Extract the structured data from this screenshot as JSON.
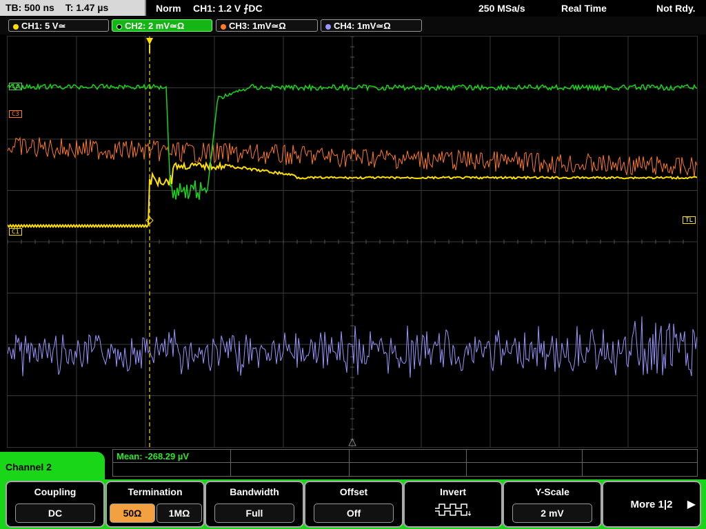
{
  "top": {
    "tb_label": "TB: 500 ns",
    "t_label": "T: 1.47 µs",
    "mode": "Norm",
    "trigger": "CH1: 1.2 V ⨍DC",
    "rate": "250 MSa/s",
    "acq": "Real Time",
    "state": "Not Rdy."
  },
  "channels": [
    {
      "label": "CH1: 5 V≃",
      "color": "#ffe000"
    },
    {
      "label": "CH2: 2 mV≃Ω",
      "color": "#19d619"
    },
    {
      "label": "CH3: 1mV≃Ω",
      "color": "#ff7a2a"
    },
    {
      "label": "CH4: 1mV≃Ω",
      "color": "#9a96ff"
    }
  ],
  "markers": {
    "c3": "C3",
    "c3b": "C3",
    "c1": "C1",
    "tl": "TL"
  },
  "measurement": {
    "mean": "Mean: -268.29 µV"
  },
  "menu": {
    "channel_title": "Channel 2",
    "coupling": {
      "title": "Coupling",
      "value": "DC"
    },
    "termination": {
      "title": "Termination",
      "opt1": "50Ω",
      "opt2": "1MΩ"
    },
    "bandwidth": {
      "title": "Bandwidth",
      "value": "Full"
    },
    "offset": {
      "title": "Offset",
      "value": "Off"
    },
    "invert": {
      "title": "Invert"
    },
    "yscale": {
      "title": "Y-Scale",
      "value": "2 mV"
    },
    "more": {
      "title": "More 1|2"
    }
  },
  "colors": {
    "ch1": "#ffe000",
    "ch2": "#19d619",
    "ch3": "#ff7a2a",
    "ch4": "#9a96ff",
    "ui_green": "#19d619"
  }
}
